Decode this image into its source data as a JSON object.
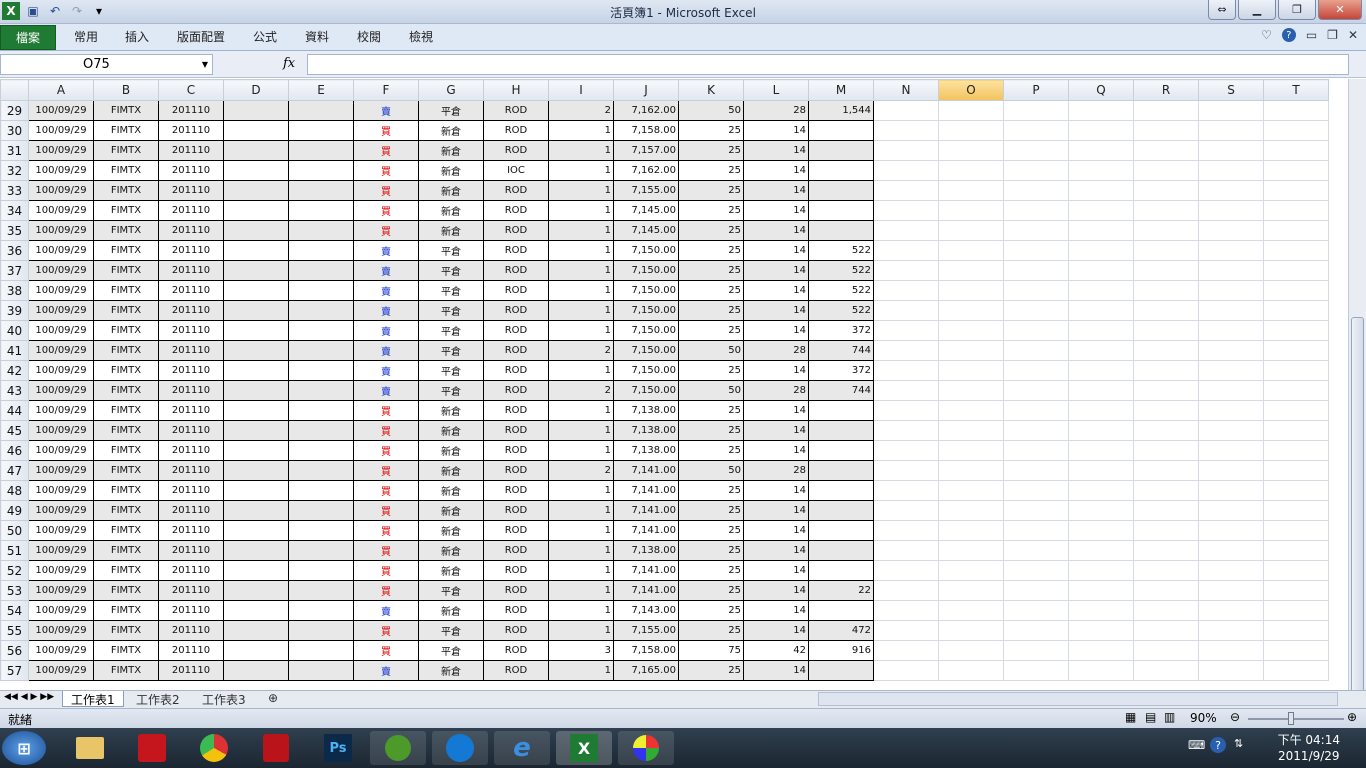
{
  "title": "活頁簿1 - Microsoft Excel",
  "ribbon_tabs": [
    "檔案",
    "常用",
    "插入",
    "版面配置",
    "公式",
    "資料",
    "校閱",
    "檢視"
  ],
  "name_box": "O75",
  "formula_icon": "fx",
  "columns": [
    "A",
    "B",
    "C",
    "D",
    "E",
    "F",
    "G",
    "H",
    "I",
    "J",
    "K",
    "L",
    "M",
    "N",
    "O",
    "P",
    "Q",
    "R",
    "S",
    "T"
  ],
  "rows": [
    {
      "n": "29",
      "a": "100/09/29",
      "b": "FIMTX",
      "c": "201110",
      "f": "賣",
      "g": "平倉",
      "h": "ROD",
      "i": "2",
      "j": "7,162.00",
      "k": "50",
      "l": "28",
      "m": "1,544"
    },
    {
      "n": "30",
      "a": "100/09/29",
      "b": "FIMTX",
      "c": "201110",
      "f": "買",
      "g": "新倉",
      "h": "ROD",
      "i": "1",
      "j": "7,158.00",
      "k": "25",
      "l": "14",
      "m": ""
    },
    {
      "n": "31",
      "a": "100/09/29",
      "b": "FIMTX",
      "c": "201110",
      "f": "買",
      "g": "新倉",
      "h": "ROD",
      "i": "1",
      "j": "7,157.00",
      "k": "25",
      "l": "14",
      "m": ""
    },
    {
      "n": "32",
      "a": "100/09/29",
      "b": "FIMTX",
      "c": "201110",
      "f": "買",
      "g": "新倉",
      "h": "IOC",
      "i": "1",
      "j": "7,162.00",
      "k": "25",
      "l": "14",
      "m": ""
    },
    {
      "n": "33",
      "a": "100/09/29",
      "b": "FIMTX",
      "c": "201110",
      "f": "買",
      "g": "新倉",
      "h": "ROD",
      "i": "1",
      "j": "7,155.00",
      "k": "25",
      "l": "14",
      "m": ""
    },
    {
      "n": "34",
      "a": "100/09/29",
      "b": "FIMTX",
      "c": "201110",
      "f": "買",
      "g": "新倉",
      "h": "ROD",
      "i": "1",
      "j": "7,145.00",
      "k": "25",
      "l": "14",
      "m": ""
    },
    {
      "n": "35",
      "a": "100/09/29",
      "b": "FIMTX",
      "c": "201110",
      "f": "買",
      "g": "新倉",
      "h": "ROD",
      "i": "1",
      "j": "7,145.00",
      "k": "25",
      "l": "14",
      "m": ""
    },
    {
      "n": "36",
      "a": "100/09/29",
      "b": "FIMTX",
      "c": "201110",
      "f": "賣",
      "g": "平倉",
      "h": "ROD",
      "i": "1",
      "j": "7,150.00",
      "k": "25",
      "l": "14",
      "m": "522"
    },
    {
      "n": "37",
      "a": "100/09/29",
      "b": "FIMTX",
      "c": "201110",
      "f": "賣",
      "g": "平倉",
      "h": "ROD",
      "i": "1",
      "j": "7,150.00",
      "k": "25",
      "l": "14",
      "m": "522"
    },
    {
      "n": "38",
      "a": "100/09/29",
      "b": "FIMTX",
      "c": "201110",
      "f": "賣",
      "g": "平倉",
      "h": "ROD",
      "i": "1",
      "j": "7,150.00",
      "k": "25",
      "l": "14",
      "m": "522"
    },
    {
      "n": "39",
      "a": "100/09/29",
      "b": "FIMTX",
      "c": "201110",
      "f": "賣",
      "g": "平倉",
      "h": "ROD",
      "i": "1",
      "j": "7,150.00",
      "k": "25",
      "l": "14",
      "m": "522"
    },
    {
      "n": "40",
      "a": "100/09/29",
      "b": "FIMTX",
      "c": "201110",
      "f": "賣",
      "g": "平倉",
      "h": "ROD",
      "i": "1",
      "j": "7,150.00",
      "k": "25",
      "l": "14",
      "m": "372"
    },
    {
      "n": "41",
      "a": "100/09/29",
      "b": "FIMTX",
      "c": "201110",
      "f": "賣",
      "g": "平倉",
      "h": "ROD",
      "i": "2",
      "j": "7,150.00",
      "k": "50",
      "l": "28",
      "m": "744"
    },
    {
      "n": "42",
      "a": "100/09/29",
      "b": "FIMTX",
      "c": "201110",
      "f": "賣",
      "g": "平倉",
      "h": "ROD",
      "i": "1",
      "j": "7,150.00",
      "k": "25",
      "l": "14",
      "m": "372"
    },
    {
      "n": "43",
      "a": "100/09/29",
      "b": "FIMTX",
      "c": "201110",
      "f": "賣",
      "g": "平倉",
      "h": "ROD",
      "i": "2",
      "j": "7,150.00",
      "k": "50",
      "l": "28",
      "m": "744"
    },
    {
      "n": "44",
      "a": "100/09/29",
      "b": "FIMTX",
      "c": "201110",
      "f": "買",
      "g": "新倉",
      "h": "ROD",
      "i": "1",
      "j": "7,138.00",
      "k": "25",
      "l": "14",
      "m": ""
    },
    {
      "n": "45",
      "a": "100/09/29",
      "b": "FIMTX",
      "c": "201110",
      "f": "買",
      "g": "新倉",
      "h": "ROD",
      "i": "1",
      "j": "7,138.00",
      "k": "25",
      "l": "14",
      "m": ""
    },
    {
      "n": "46",
      "a": "100/09/29",
      "b": "FIMTX",
      "c": "201110",
      "f": "買",
      "g": "新倉",
      "h": "ROD",
      "i": "1",
      "j": "7,138.00",
      "k": "25",
      "l": "14",
      "m": ""
    },
    {
      "n": "47",
      "a": "100/09/29",
      "b": "FIMTX",
      "c": "201110",
      "f": "買",
      "g": "新倉",
      "h": "ROD",
      "i": "2",
      "j": "7,141.00",
      "k": "50",
      "l": "28",
      "m": ""
    },
    {
      "n": "48",
      "a": "100/09/29",
      "b": "FIMTX",
      "c": "201110",
      "f": "買",
      "g": "新倉",
      "h": "ROD",
      "i": "1",
      "j": "7,141.00",
      "k": "25",
      "l": "14",
      "m": ""
    },
    {
      "n": "49",
      "a": "100/09/29",
      "b": "FIMTX",
      "c": "201110",
      "f": "買",
      "g": "新倉",
      "h": "ROD",
      "i": "1",
      "j": "7,141.00",
      "k": "25",
      "l": "14",
      "m": ""
    },
    {
      "n": "50",
      "a": "100/09/29",
      "b": "FIMTX",
      "c": "201110",
      "f": "買",
      "g": "新倉",
      "h": "ROD",
      "i": "1",
      "j": "7,141.00",
      "k": "25",
      "l": "14",
      "m": ""
    },
    {
      "n": "51",
      "a": "100/09/29",
      "b": "FIMTX",
      "c": "201110",
      "f": "買",
      "g": "新倉",
      "h": "ROD",
      "i": "1",
      "j": "7,138.00",
      "k": "25",
      "l": "14",
      "m": ""
    },
    {
      "n": "52",
      "a": "100/09/29",
      "b": "FIMTX",
      "c": "201110",
      "f": "買",
      "g": "新倉",
      "h": "ROD",
      "i": "1",
      "j": "7,141.00",
      "k": "25",
      "l": "14",
      "m": ""
    },
    {
      "n": "53",
      "a": "100/09/29",
      "b": "FIMTX",
      "c": "201110",
      "f": "買",
      "g": "平倉",
      "h": "ROD",
      "i": "1",
      "j": "7,141.00",
      "k": "25",
      "l": "14",
      "m": "22"
    },
    {
      "n": "54",
      "a": "100/09/29",
      "b": "FIMTX",
      "c": "201110",
      "f": "賣",
      "g": "新倉",
      "h": "ROD",
      "i": "1",
      "j": "7,143.00",
      "k": "25",
      "l": "14",
      "m": ""
    },
    {
      "n": "55",
      "a": "100/09/29",
      "b": "FIMTX",
      "c": "201110",
      "f": "買",
      "g": "平倉",
      "h": "ROD",
      "i": "1",
      "j": "7,155.00",
      "k": "25",
      "l": "14",
      "m": "472"
    },
    {
      "n": "56",
      "a": "100/09/29",
      "b": "FIMTX",
      "c": "201110",
      "f": "買",
      "g": "平倉",
      "h": "ROD",
      "i": "3",
      "j": "7,158.00",
      "k": "75",
      "l": "42",
      "m": "916"
    },
    {
      "n": "57",
      "a": "100/09/29",
      "b": "FIMTX",
      "c": "201110",
      "f": "賣",
      "g": "新倉",
      "h": "ROD",
      "i": "1",
      "j": "7,165.00",
      "k": "25",
      "l": "14",
      "m": ""
    }
  ],
  "sheet_tabs": [
    "工作表1",
    "工作表2",
    "工作表3"
  ],
  "status": {
    "ready": "就緒",
    "zoom": "90%"
  },
  "clock": {
    "time": "下午 04:14",
    "date": "2011/9/29"
  },
  "colors": {
    "sell": "#1030d0",
    "buy": "#e00000",
    "file_tab": "#1f7a33"
  }
}
